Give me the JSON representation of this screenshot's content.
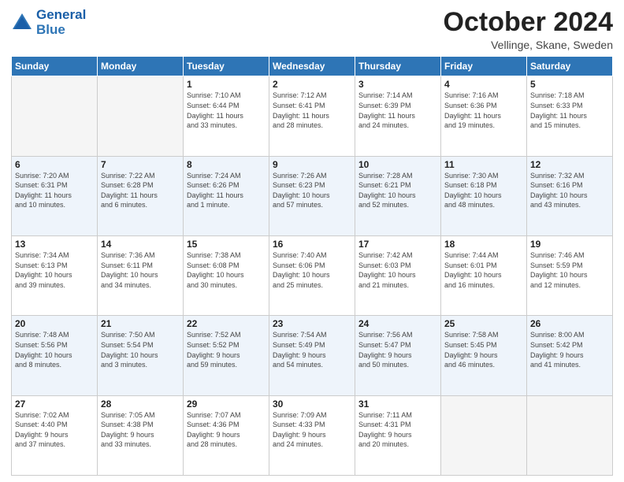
{
  "logo": {
    "line1": "General",
    "line2": "Blue"
  },
  "header": {
    "month": "October 2024",
    "location": "Vellinge, Skane, Sweden"
  },
  "weekdays": [
    "Sunday",
    "Monday",
    "Tuesday",
    "Wednesday",
    "Thursday",
    "Friday",
    "Saturday"
  ],
  "weeks": [
    [
      {
        "day": "",
        "info": ""
      },
      {
        "day": "",
        "info": ""
      },
      {
        "day": "1",
        "info": "Sunrise: 7:10 AM\nSunset: 6:44 PM\nDaylight: 11 hours\nand 33 minutes."
      },
      {
        "day": "2",
        "info": "Sunrise: 7:12 AM\nSunset: 6:41 PM\nDaylight: 11 hours\nand 28 minutes."
      },
      {
        "day": "3",
        "info": "Sunrise: 7:14 AM\nSunset: 6:39 PM\nDaylight: 11 hours\nand 24 minutes."
      },
      {
        "day": "4",
        "info": "Sunrise: 7:16 AM\nSunset: 6:36 PM\nDaylight: 11 hours\nand 19 minutes."
      },
      {
        "day": "5",
        "info": "Sunrise: 7:18 AM\nSunset: 6:33 PM\nDaylight: 11 hours\nand 15 minutes."
      }
    ],
    [
      {
        "day": "6",
        "info": "Sunrise: 7:20 AM\nSunset: 6:31 PM\nDaylight: 11 hours\nand 10 minutes."
      },
      {
        "day": "7",
        "info": "Sunrise: 7:22 AM\nSunset: 6:28 PM\nDaylight: 11 hours\nand 6 minutes."
      },
      {
        "day": "8",
        "info": "Sunrise: 7:24 AM\nSunset: 6:26 PM\nDaylight: 11 hours\nand 1 minute."
      },
      {
        "day": "9",
        "info": "Sunrise: 7:26 AM\nSunset: 6:23 PM\nDaylight: 10 hours\nand 57 minutes."
      },
      {
        "day": "10",
        "info": "Sunrise: 7:28 AM\nSunset: 6:21 PM\nDaylight: 10 hours\nand 52 minutes."
      },
      {
        "day": "11",
        "info": "Sunrise: 7:30 AM\nSunset: 6:18 PM\nDaylight: 10 hours\nand 48 minutes."
      },
      {
        "day": "12",
        "info": "Sunrise: 7:32 AM\nSunset: 6:16 PM\nDaylight: 10 hours\nand 43 minutes."
      }
    ],
    [
      {
        "day": "13",
        "info": "Sunrise: 7:34 AM\nSunset: 6:13 PM\nDaylight: 10 hours\nand 39 minutes."
      },
      {
        "day": "14",
        "info": "Sunrise: 7:36 AM\nSunset: 6:11 PM\nDaylight: 10 hours\nand 34 minutes."
      },
      {
        "day": "15",
        "info": "Sunrise: 7:38 AM\nSunset: 6:08 PM\nDaylight: 10 hours\nand 30 minutes."
      },
      {
        "day": "16",
        "info": "Sunrise: 7:40 AM\nSunset: 6:06 PM\nDaylight: 10 hours\nand 25 minutes."
      },
      {
        "day": "17",
        "info": "Sunrise: 7:42 AM\nSunset: 6:03 PM\nDaylight: 10 hours\nand 21 minutes."
      },
      {
        "day": "18",
        "info": "Sunrise: 7:44 AM\nSunset: 6:01 PM\nDaylight: 10 hours\nand 16 minutes."
      },
      {
        "day": "19",
        "info": "Sunrise: 7:46 AM\nSunset: 5:59 PM\nDaylight: 10 hours\nand 12 minutes."
      }
    ],
    [
      {
        "day": "20",
        "info": "Sunrise: 7:48 AM\nSunset: 5:56 PM\nDaylight: 10 hours\nand 8 minutes."
      },
      {
        "day": "21",
        "info": "Sunrise: 7:50 AM\nSunset: 5:54 PM\nDaylight: 10 hours\nand 3 minutes."
      },
      {
        "day": "22",
        "info": "Sunrise: 7:52 AM\nSunset: 5:52 PM\nDaylight: 9 hours\nand 59 minutes."
      },
      {
        "day": "23",
        "info": "Sunrise: 7:54 AM\nSunset: 5:49 PM\nDaylight: 9 hours\nand 54 minutes."
      },
      {
        "day": "24",
        "info": "Sunrise: 7:56 AM\nSunset: 5:47 PM\nDaylight: 9 hours\nand 50 minutes."
      },
      {
        "day": "25",
        "info": "Sunrise: 7:58 AM\nSunset: 5:45 PM\nDaylight: 9 hours\nand 46 minutes."
      },
      {
        "day": "26",
        "info": "Sunrise: 8:00 AM\nSunset: 5:42 PM\nDaylight: 9 hours\nand 41 minutes."
      }
    ],
    [
      {
        "day": "27",
        "info": "Sunrise: 7:02 AM\nSunset: 4:40 PM\nDaylight: 9 hours\nand 37 minutes."
      },
      {
        "day": "28",
        "info": "Sunrise: 7:05 AM\nSunset: 4:38 PM\nDaylight: 9 hours\nand 33 minutes."
      },
      {
        "day": "29",
        "info": "Sunrise: 7:07 AM\nSunset: 4:36 PM\nDaylight: 9 hours\nand 28 minutes."
      },
      {
        "day": "30",
        "info": "Sunrise: 7:09 AM\nSunset: 4:33 PM\nDaylight: 9 hours\nand 24 minutes."
      },
      {
        "day": "31",
        "info": "Sunrise: 7:11 AM\nSunset: 4:31 PM\nDaylight: 9 hours\nand 20 minutes."
      },
      {
        "day": "",
        "info": ""
      },
      {
        "day": "",
        "info": ""
      }
    ]
  ]
}
